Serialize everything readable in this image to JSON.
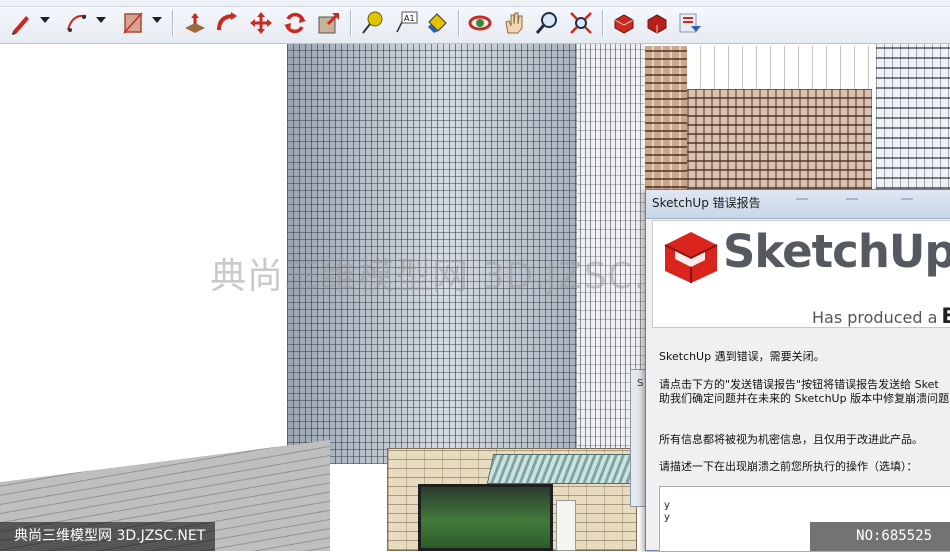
{
  "toolbar": {
    "tools": [
      {
        "name": "pencil-icon"
      },
      {
        "name": "arc-icon"
      },
      {
        "name": "rectangle-icon"
      },
      {
        "name": "push-pull-icon"
      },
      {
        "name": "follow-me-icon"
      },
      {
        "name": "move-icon"
      },
      {
        "name": "rotate-icon"
      },
      {
        "name": "scale-icon"
      },
      {
        "name": "tape-measure-icon"
      },
      {
        "name": "text-icon"
      },
      {
        "name": "paint-bucket-icon"
      },
      {
        "name": "orbit-icon"
      },
      {
        "name": "pan-icon"
      },
      {
        "name": "zoom-icon"
      },
      {
        "name": "zoom-extents-icon"
      },
      {
        "name": "previous-view-icon"
      },
      {
        "name": "next-view-icon"
      },
      {
        "name": "warehouse-icon"
      }
    ],
    "text_tool_label": "A1"
  },
  "dialog": {
    "title": "SketchUp 错误报告",
    "brand": "SketchUp",
    "has_produced": "Has produced a",
    "has_produced_bold": "BU",
    "line1": "SketchUp 遇到错误，需要关闭。",
    "line2": "请点击下方的\"发送错误报告\"按钮将错误报告发送给 Sket",
    "line3": "助我们确定问题并在未来的 SketchUp 版本中修复崩溃问题",
    "line4": "所有信息都将被视为机密信息，且仅用于改进此产品。",
    "line5": "请描述一下在出现崩溃之前您所执行的操作（选填）：",
    "textarea_line1": "y",
    "textarea_line2": "y"
  },
  "behind_dialog": {
    "fragment": "S"
  },
  "watermark": {
    "center": "典尚三维模型网 3D.JZSC.NET",
    "bottom_left": "典尚三维模型网 3D.JZSC.NET",
    "bottom_right": "NO:685525"
  },
  "colors": {
    "sketchup_red": "#d9251d",
    "toolbar_bg": "#eef2f7",
    "dialog_bg": "#f0f0f0"
  }
}
